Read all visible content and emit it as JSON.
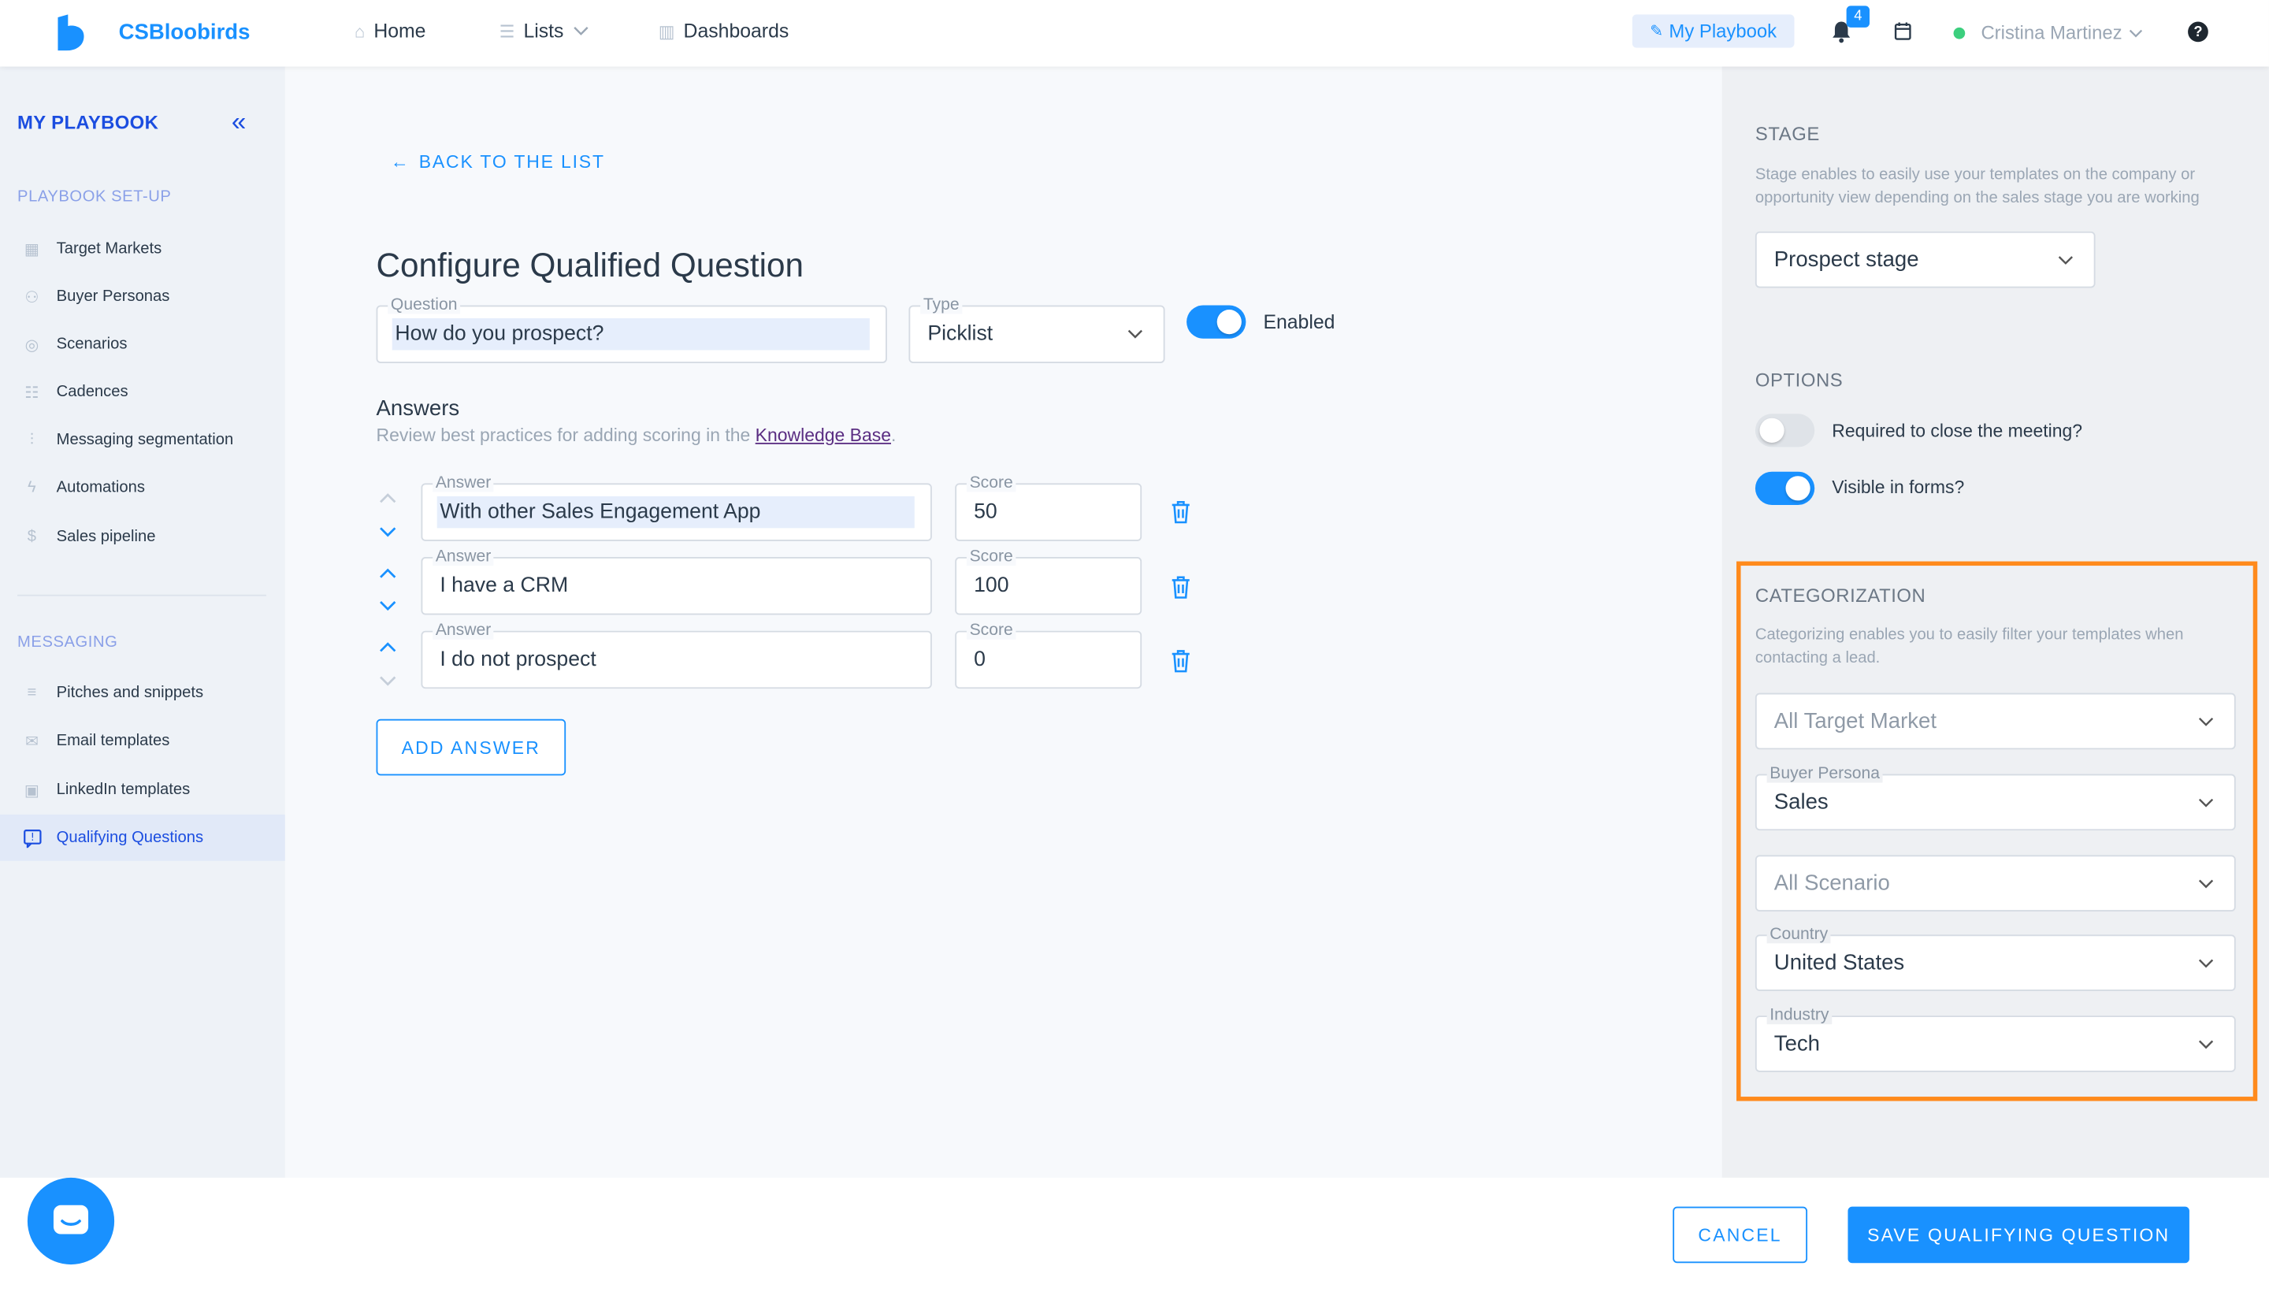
{
  "topnav": {
    "brand": "CSBloobirds",
    "home": "Home",
    "lists": "Lists",
    "dashboards": "Dashboards",
    "my_playbook": "My Playbook",
    "notification_count": "4",
    "user_name": "Cristina Martinez",
    "help": "?"
  },
  "sidebar": {
    "title": "MY PLAYBOOK",
    "section_setup": "PLAYBOOK SET-UP",
    "setup_items": [
      "Target Markets",
      "Buyer Personas",
      "Scenarios",
      "Cadences",
      "Messaging segmentation",
      "Automations",
      "Sales pipeline"
    ],
    "section_messaging": "MESSAGING",
    "messaging_items": [
      "Pitches and snippets",
      "Email templates",
      "LinkedIn templates",
      "Qualifying Questions"
    ]
  },
  "main": {
    "back": "BACK TO THE LIST",
    "title": "Configure Qualified Question",
    "question_label": "Question",
    "question_value": "How do you prospect?",
    "type_label": "Type",
    "type_value": "Picklist",
    "enabled_label": "Enabled",
    "answers_heading": "Answers",
    "answers_desc": "Review best practices for adding scoring in the ",
    "kb_link": "Knowledge Base",
    "answers_desc_end": ".",
    "answer_label": "Answer",
    "score_label": "Score",
    "answers": [
      {
        "answer": "With other Sales Engagement App",
        "score": "50"
      },
      {
        "answer": "I have a CRM",
        "score": "100"
      },
      {
        "answer": "I do not prospect",
        "score": "0"
      }
    ],
    "add_answer": "ADD ANSWER"
  },
  "right_panel": {
    "stage_heading": "STAGE",
    "stage_desc": "Stage enables to easily use your templates on the company or opportunity view depending on the sales stage you are working",
    "stage_value": "Prospect stage",
    "options_heading": "OPTIONS",
    "option_required": "Required to close the meeting?",
    "option_visible": "Visible in forms?",
    "categorization_heading": "CATEGORIZATION",
    "categorization_desc": "Categorizing enables you to easily filter your templates when contacting a lead.",
    "target_market_placeholder": "All Target Market",
    "buyer_persona_label": "Buyer Persona",
    "buyer_persona_value": "Sales",
    "scenario_placeholder": "All Scenario",
    "country_label": "Country",
    "country_value": "United States",
    "industry_label": "Industry",
    "industry_value": "Tech"
  },
  "footer": {
    "cancel": "CANCEL",
    "save": "SAVE QUALIFYING QUESTION"
  },
  "colors": {
    "accent": "#1991ff",
    "sidebar_accent": "#1b4de0",
    "highlight": "#ff8a1c"
  }
}
